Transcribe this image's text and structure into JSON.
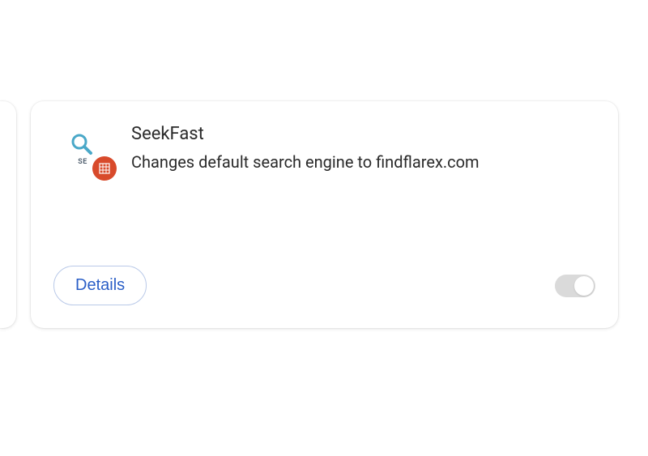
{
  "extension": {
    "name": "SeekFast",
    "description": "Changes default search engine to findflarex.com",
    "icon_label": "SE",
    "details_label": "Details",
    "toggle_state": "off",
    "badge_color": "#d84a2b",
    "accent_color": "#2b5fc7"
  }
}
